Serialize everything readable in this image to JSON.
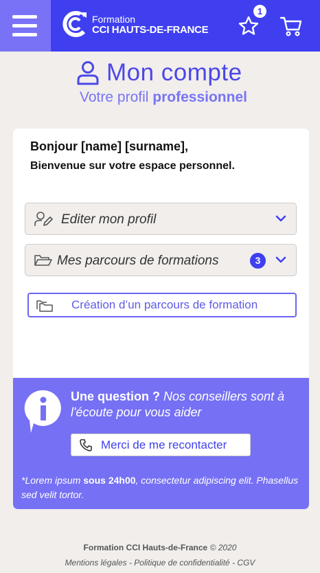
{
  "header": {
    "logo_top": "Formation",
    "logo_bottom": "CCI HAUTS-DE-FRANCE",
    "favorites_count": "1",
    "menu_icon": "hamburger-icon",
    "favorites_icon": "star-icon",
    "cart_icon": "cart-icon"
  },
  "page": {
    "title": "Mon compte",
    "subtitle_prefix": "Votre profil ",
    "subtitle_bold": "professionnel"
  },
  "card": {
    "greeting": "Bonjour [name] [surname],",
    "welcome": "Bienvenue sur votre espace personnel.",
    "accordions": [
      {
        "label": "Editer mon profil",
        "icon": "user-edit-icon"
      },
      {
        "label": "Mes parcours de formations",
        "icon": "folder-open-icon",
        "count": "3"
      }
    ],
    "create_button": "Création d’un parcours de formation"
  },
  "help": {
    "question_bold": "Une question ?",
    "question_rest": " Nos conseillers sont à l'écoute pour vous aider",
    "callback_button": "Merci de me recontacter",
    "note_start": "*Lorem ipsum ",
    "note_bold": "sous 24h00",
    "note_end": ", consectetur adipiscing elit. Phasellus sed velit tortor."
  },
  "footer": {
    "brand": "Formation CCI Hauts-de-France",
    "copyright": " © 2020",
    "links": [
      "Mentions légales",
      "Politique de confidentialité",
      "CGV"
    ],
    "separator": " - "
  },
  "colors": {
    "header_bg": "#3f3ff0",
    "menu_bg": "#7a72f6",
    "accent": "#4b48e6",
    "help_bg": "#7570f4",
    "page_bg": "#f1eeec"
  }
}
